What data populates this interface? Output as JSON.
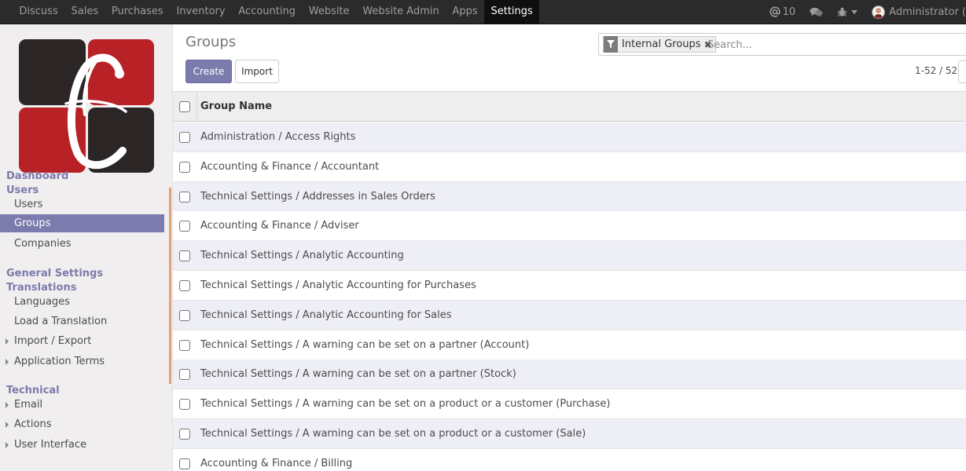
{
  "navbar": {
    "menu": [
      {
        "label": "Discuss",
        "active": false
      },
      {
        "label": "Sales",
        "active": false
      },
      {
        "label": "Purchases",
        "active": false
      },
      {
        "label": "Inventory",
        "active": false
      },
      {
        "label": "Accounting",
        "active": false
      },
      {
        "label": "Website",
        "active": false
      },
      {
        "label": "Website Admin",
        "active": false
      },
      {
        "label": "Apps",
        "active": false
      },
      {
        "label": "Settings",
        "active": true
      }
    ],
    "messages_icon": "at-icon",
    "messages_count": "10",
    "chat_icon": "chat-bubbles-icon",
    "debug_icon": "bug-icon",
    "user_name": "Administrator (",
    "accent": "#7c7bad"
  },
  "sidebar": {
    "sections": [
      {
        "type": "header",
        "label": "Dashboard"
      },
      {
        "type": "header",
        "label": "Users"
      },
      {
        "type": "item",
        "label": "Users",
        "active": false,
        "expandable": false
      },
      {
        "type": "item",
        "label": "Groups",
        "active": true,
        "expandable": false
      },
      {
        "type": "item",
        "label": "Companies",
        "active": false,
        "expandable": false
      },
      {
        "type": "header",
        "label": "General Settings"
      },
      {
        "type": "header",
        "label": "Translations"
      },
      {
        "type": "item",
        "label": "Languages",
        "active": false,
        "expandable": false
      },
      {
        "type": "item",
        "label": "Load a Translation",
        "active": false,
        "expandable": false
      },
      {
        "type": "item",
        "label": "Import / Export",
        "active": false,
        "expandable": true
      },
      {
        "type": "item",
        "label": "Application Terms",
        "active": false,
        "expandable": true
      },
      {
        "type": "header",
        "label": "Technical"
      },
      {
        "type": "item",
        "label": "Email",
        "active": false,
        "expandable": true
      },
      {
        "type": "item",
        "label": "Actions",
        "active": false,
        "expandable": true
      },
      {
        "type": "item",
        "label": "User Interface",
        "active": false,
        "expandable": true
      }
    ]
  },
  "control": {
    "title": "Groups",
    "create_label": "Create",
    "import_label": "Import",
    "filter_facet": "Internal Groups",
    "search_placeholder": "Search...",
    "pager": "1-52 / 52"
  },
  "list": {
    "column_header": "Group Name",
    "rows": [
      "Administration / Access Rights",
      "Accounting & Finance / Accountant",
      "Technical Settings / Addresses in Sales Orders",
      "Accounting & Finance / Adviser",
      "Technical Settings / Analytic Accounting",
      "Technical Settings / Analytic Accounting for Purchases",
      "Technical Settings / Analytic Accounting for Sales",
      "Technical Settings / A warning can be set on a partner (Account)",
      "Technical Settings / A warning can be set on a partner (Stock)",
      "Technical Settings / A warning can be set on a product or a customer (Purchase)",
      "Technical Settings / A warning can be set on a product or a customer (Sale)",
      "Accounting & Finance / Billing"
    ]
  }
}
